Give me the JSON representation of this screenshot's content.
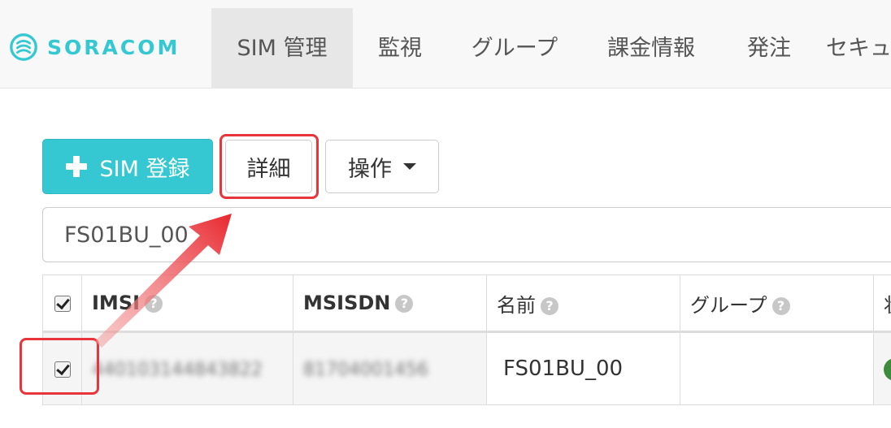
{
  "brand": {
    "name": "SORACOM"
  },
  "nav": [
    {
      "label": "SIM 管理",
      "active": true
    },
    {
      "label": "監視"
    },
    {
      "label": "グループ"
    },
    {
      "label": "課金情報"
    },
    {
      "label": "発注"
    },
    {
      "label": "セキュ"
    }
  ],
  "toolbar": {
    "register_label": "SIM 登録",
    "detail_label": "詳細",
    "operation_label": "操作"
  },
  "search": {
    "value": "FS01BU_00"
  },
  "table": {
    "headers": [
      "IMSI",
      "MSISDN",
      "名前",
      "グループ",
      "状"
    ],
    "rows": [
      {
        "imsi": "440103144843822",
        "msisdn": "81704001456",
        "name": "FS01BU_00",
        "group": ""
      }
    ]
  },
  "icons": {
    "help": "?"
  },
  "colors": {
    "brand": "#34c8d3",
    "primary_button": "#35c8d3",
    "highlight": "#e8353b",
    "status_online": "#3c8c3c"
  }
}
